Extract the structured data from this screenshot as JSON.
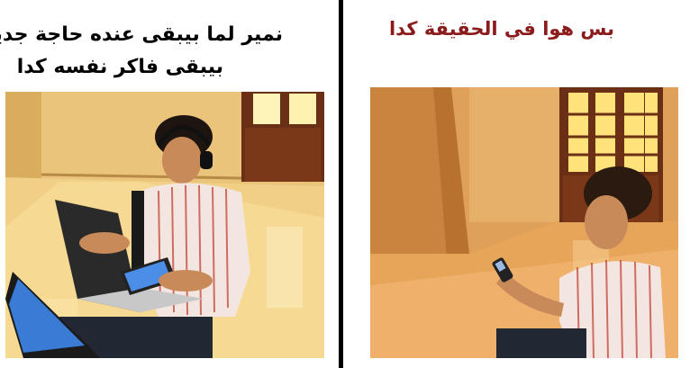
{
  "left": {
    "caption_line1": "نمير لما بيبقى عنده حاجة جديدة",
    "caption_line2": "بيبقى فاكر نفسه كدا"
  },
  "right": {
    "caption": "بس هوا في الحقيقة كدا"
  },
  "colors": {
    "caption_left": "#000000",
    "caption_right": "#8b1a1a",
    "divider": "#000000"
  }
}
